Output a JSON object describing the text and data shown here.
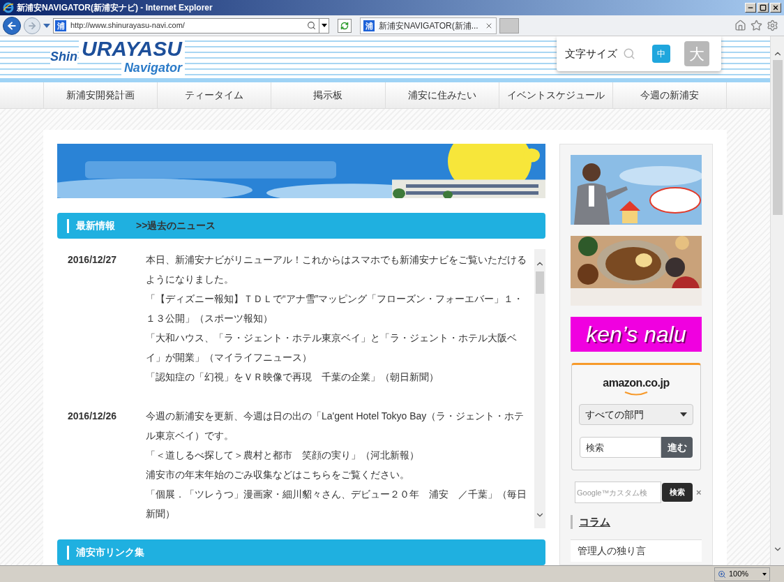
{
  "window": {
    "title": "新浦安NAVIGATOR(新浦安ナビ) - Internet Explorer"
  },
  "address_bar": {
    "favicon": "浦",
    "url": "http://www.shinurayasu-navi.com/"
  },
  "tabs": [
    {
      "favicon": "浦",
      "label": "新浦安NAVIGATOR(新浦...",
      "selected": true
    }
  ],
  "header": {
    "logo": {
      "small": "Shin",
      "main": "URAYASU",
      "sub": "Navigator"
    },
    "font_size": {
      "label": "文字サイズ",
      "options": [
        {
          "label": "中",
          "selected": true
        },
        {
          "label": "大",
          "selected": false
        }
      ]
    }
  },
  "nav": [
    "新浦安開発計画",
    "ティータイム",
    "掲示板",
    "浦安に住みたい",
    "イベントスケジュール",
    "今週の新浦安"
  ],
  "news": {
    "title": "最新情報",
    "link": ">>過去のニュース",
    "entries": [
      {
        "date": "2016/12/27",
        "lines": [
          "本日、新浦安ナビがリニューアル！これからはスマホでも新浦安ナビをご覧いただけるようになりました。",
          "「【ディズニー報知】ＴＤＬで“アナ雪”マッピング「フローズン・フォーエバー」１・１３公開」（スポーツ報知）",
          "「大和ハウス、「ラ・ジェント・ホテル東京ベイ」と「ラ・ジェント・ホテル大阪ベイ」が開業」（マイライフニュース）",
          "「認知症の「幻視」をＶＲ映像で再現　千葉の企業」（朝日新聞）"
        ]
      },
      {
        "date": "2016/12/26",
        "lines": [
          "今週の新浦安を更新、今週は日の出の「La'gent Hotel Tokyo Bay（ラ・ジェント・ホテル東京ベイ）です。",
          "「＜道しるべ探して＞農村と都市　笑顔の実り」（河北新報）",
          "浦安市の年末年始のごみ収集などはこちらをご覧ください。",
          "「個展．「ツレうつ」漫画家・細川貂々さん、デビュー２０年　浦安　／千葉」（毎日新聞）"
        ]
      }
    ]
  },
  "next_section": {
    "title": "浦安市リンク集"
  },
  "sidebar": {
    "banner_text": "ken’s nalu",
    "amazon": {
      "logo": "amazon.co.jp",
      "category": "すべての部門",
      "search_placeholder": "検索",
      "button": "進む"
    },
    "google": {
      "placeholder": "Google™カスタム検",
      "button": "検索",
      "clear": "×"
    },
    "column": {
      "title": "コラム",
      "items": [
        "管理人の独り言"
      ]
    }
  },
  "status_bar": {
    "zoom": "100%"
  }
}
